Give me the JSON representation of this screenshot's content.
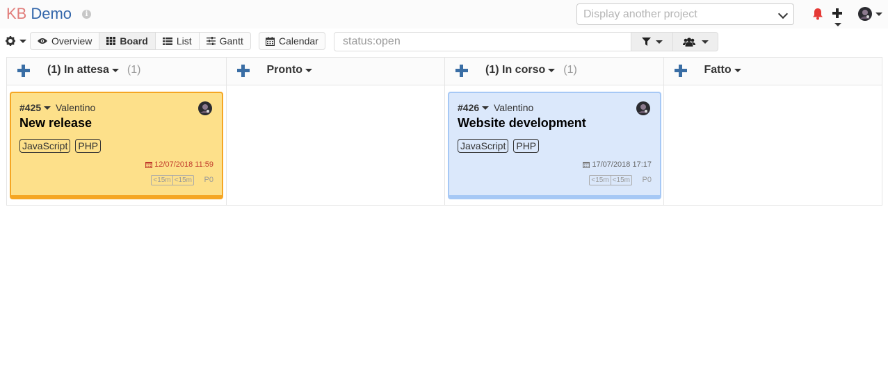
{
  "header": {
    "logo_prefix": "KB",
    "project_name": "Demo",
    "info_icon": "i",
    "project_select_placeholder": "Display another project"
  },
  "toolbar": {
    "views": [
      {
        "label": "Overview",
        "icon": "eye-icon"
      },
      {
        "label": "Board",
        "icon": "grid-icon",
        "active": true
      },
      {
        "label": "List",
        "icon": "list-icon"
      },
      {
        "label": "Gantt",
        "icon": "sliders-icon"
      }
    ],
    "calendar_label": "Calendar",
    "search_value": "status:open"
  },
  "columns": [
    {
      "title": "(1) In attesa",
      "count": "(1)"
    },
    {
      "title": "Pronto",
      "count": ""
    },
    {
      "title": "(1) In corso",
      "count": "(1)"
    },
    {
      "title": "Fatto",
      "count": ""
    }
  ],
  "tasks": [
    {
      "id": "#425",
      "owner": "Valentino",
      "title": "New release",
      "tags": [
        "JavaScript",
        "PHP"
      ],
      "due": "12/07/2018 11:59",
      "estimate": "<15m",
      "spent": "<15m",
      "priority": "P0",
      "color": "#fde08a"
    },
    {
      "id": "#426",
      "owner": "Valentino",
      "title": "Website development",
      "tags": [
        "JavaScript",
        "PHP"
      ],
      "due": "17/07/2018 17:17",
      "estimate": "<15m",
      "spent": "<15m",
      "priority": "P0",
      "color": "#dbe8fb"
    }
  ],
  "colors": {
    "accent": "#3a6ea5",
    "bell": "#e53935",
    "due_overdue": "#c0392b"
  }
}
